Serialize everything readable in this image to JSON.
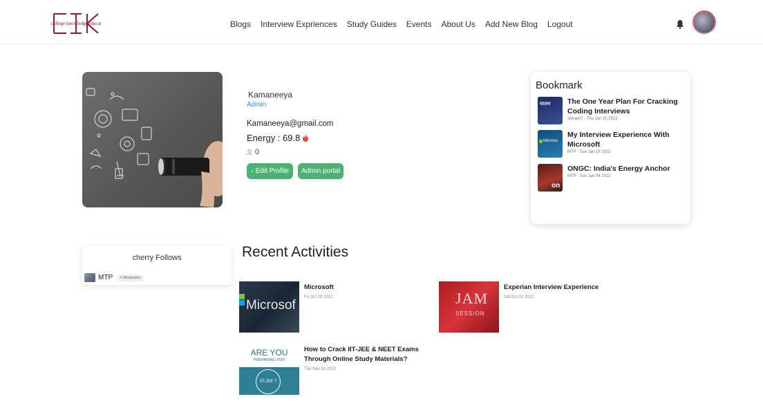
{
  "logo": {
    "text": "college knowledge education"
  },
  "nav": [
    "Blogs",
    "Interview Expriences",
    "Study Guides",
    "Events",
    "About Us",
    "Add New Blog",
    "Logout"
  ],
  "icons": {
    "bell": "bell-icon",
    "flame": "flame-icon",
    "user": "user-icon",
    "edit": "pencil-icon"
  },
  "profile": {
    "name": "Kamaneeya",
    "role": "Admin",
    "email": "Kamaneeya@gmail.com",
    "energy": "Energy : 69.8",
    "count": "0",
    "edit_label": "Edit Profile",
    "admin_label": "Admin portal"
  },
  "bookmark": {
    "title": "Bookmark",
    "items": [
      {
        "title": "The One Year Plan For Cracking Coding Interviews",
        "meta": "shivam7 - Thu Jan 20 2022",
        "thumb_text": "सालम"
      },
      {
        "title": "My Interview Experience With Microsoft",
        "meta": "MTP - Tue Jan 18 2022",
        "thumb_text": "Microso"
      },
      {
        "title": "ONGC: India's Energy Anchor",
        "meta": "MTP - Tue Jan 04 2022",
        "thumb_text": "on"
      }
    ]
  },
  "follows": {
    "title": "cherry Follows",
    "items": [
      {
        "name": "MTP",
        "badge": "# Moderator"
      }
    ]
  },
  "recent": {
    "title": "Recent Activities",
    "items": [
      {
        "title": "Microsoft",
        "date": "Fri Oct 28 2022",
        "thumb_text": "Microsof"
      },
      {
        "title": "Experian Interview Experience",
        "date": "Sat Oct 01 2022",
        "thumb_text": "JAM",
        "thumb_sub": "SESSION"
      },
      {
        "title": "How to Crack IIT-JEE & NEET Exams Through Online Study Materials?",
        "date": "Thu Sep 01 2022",
        "thumb_text": "ARE YOU",
        "thumb_sub": "PREPARING FOR",
        "thumb_circle": "IIT-JEE ?"
      }
    ]
  },
  "colors": {
    "accent_green": "#4bb274",
    "admin_blue": "#3a8fc8",
    "logo_red": "#8a1c2b"
  }
}
